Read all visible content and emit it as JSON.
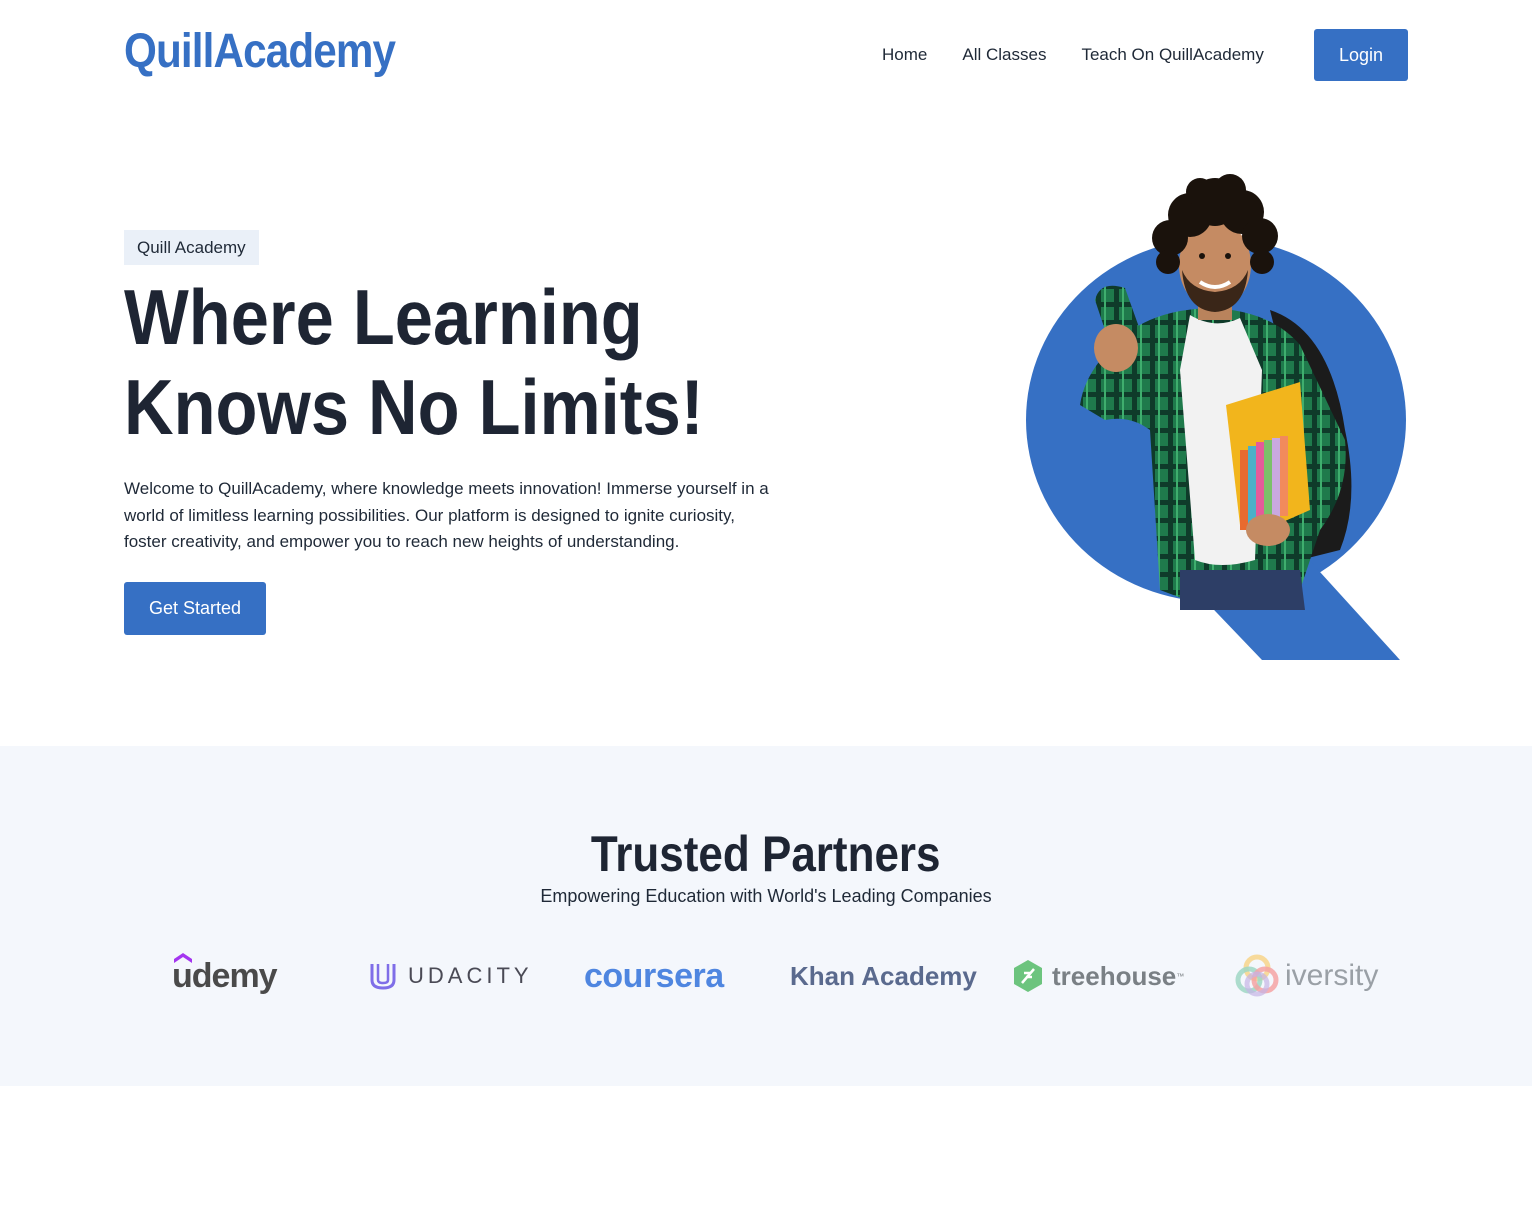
{
  "header": {
    "logo": "QuillAcademy",
    "nav": [
      {
        "label": "Home"
      },
      {
        "label": "All Classes"
      },
      {
        "label": "Teach On QuillAcademy"
      }
    ],
    "login_label": "Login"
  },
  "hero": {
    "badge": "Quill Academy",
    "title_line1": "Where Learning",
    "title_line2": "Knows No Limits!",
    "description": "Welcome to QuillAcademy, where knowledge meets innovation! Immerse yourself in a world of limitless learning possibilities. Our platform is designed to ignite curiosity, foster creativity, and empower you to reach new heights of understanding.",
    "cta_label": "Get Started",
    "accent_color": "#3670c4"
  },
  "partners": {
    "title": "Trusted Partners",
    "subtitle": "Empowering Education with World's Leading Companies",
    "logos": [
      {
        "name": "udemy",
        "icon": "udemy-hat-icon"
      },
      {
        "name": "UDACITY",
        "icon": "udacity-u-icon"
      },
      {
        "name": "coursera",
        "icon": ""
      },
      {
        "name": "Khan Academy",
        "icon": ""
      },
      {
        "name": "treehouse",
        "icon": "treehouse-leaf-icon"
      },
      {
        "name": "iversity",
        "icon": "iversity-rings-icon"
      }
    ]
  }
}
